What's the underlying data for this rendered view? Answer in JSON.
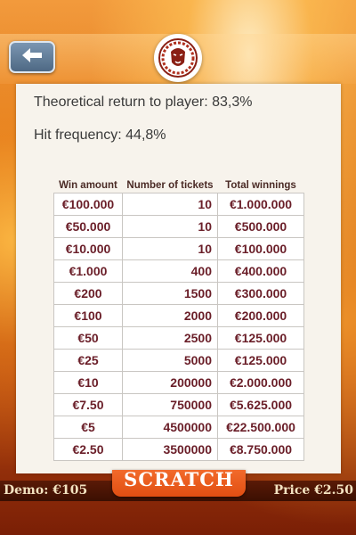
{
  "header": {
    "back_icon": "arrow-left-icon",
    "logo_icon": "lion-logo-icon"
  },
  "info": {
    "rtp": "Theoretical return to player: 83,3%",
    "hit_frequency": "Hit frequency: 44,8%"
  },
  "prize_table": {
    "headers": [
      "Win amount",
      "Number of tickets",
      "Total winnings"
    ],
    "rows": [
      [
        "€100.000",
        "10",
        "€1.000.000"
      ],
      [
        "€50.000",
        "10",
        "€500.000"
      ],
      [
        "€10.000",
        "10",
        "€100.000"
      ],
      [
        "€1.000",
        "400",
        "€400.000"
      ],
      [
        "€200",
        "1500",
        "€300.000"
      ],
      [
        "€100",
        "2000",
        "€200.000"
      ],
      [
        "€50",
        "2500",
        "€125.000"
      ],
      [
        "€25",
        "5000",
        "€125.000"
      ],
      [
        "€10",
        "200000",
        "€2.000.000"
      ],
      [
        "€7.50",
        "750000",
        "€5.625.000"
      ],
      [
        "€5",
        "4500000",
        "€22.500.000"
      ],
      [
        "€2.50",
        "3500000",
        "€8.750.000"
      ]
    ]
  },
  "footer": {
    "scratch_label": "SCRATCH",
    "demo": "Demo: €105",
    "price": "Price €2.50"
  },
  "colors": {
    "accent": "#e14e12",
    "table_text": "#6a1e28",
    "panel_bg": "#f7f3ec"
  }
}
